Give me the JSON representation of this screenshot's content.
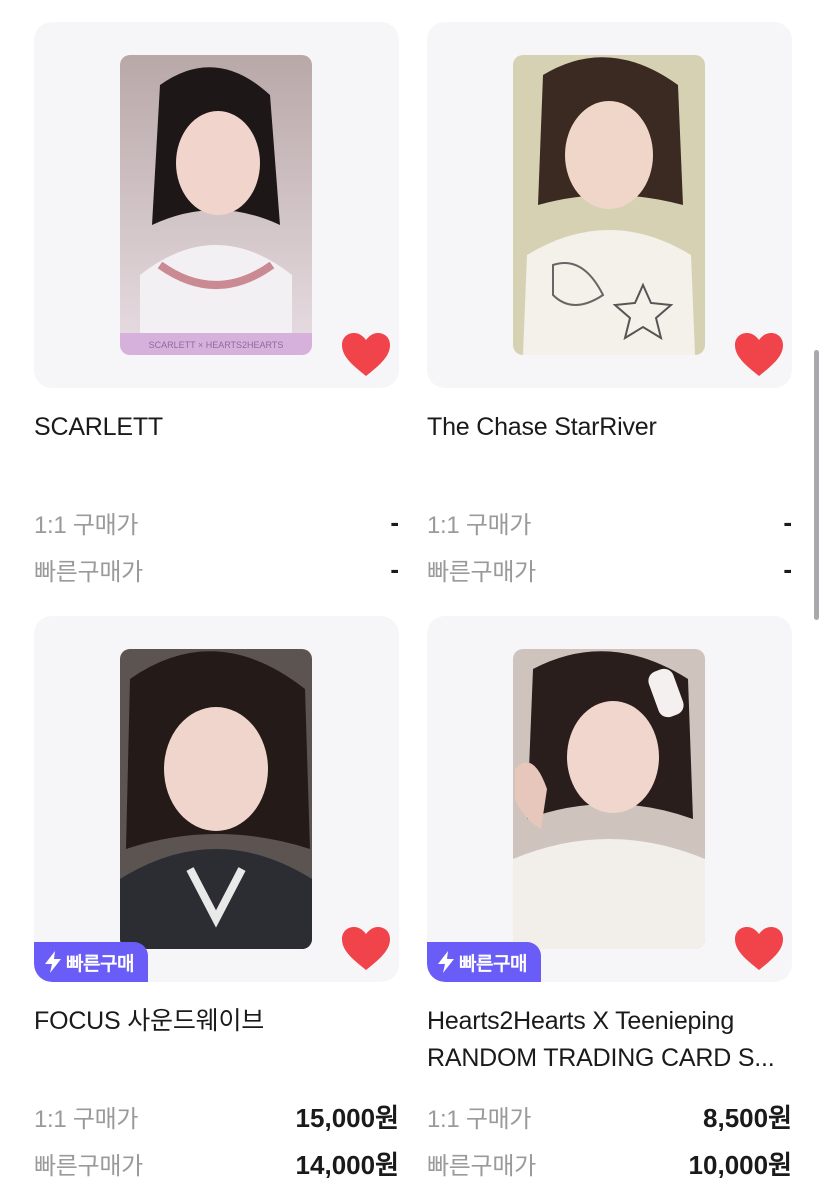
{
  "products": [
    {
      "title": "SCARLETT",
      "photo_label": "SCARLETT × HEARTS2HEARTS",
      "fast_badge": "",
      "one_to_one_label": "1:1 구매가",
      "one_to_one_price": "-",
      "fast_label": "빠른구매가",
      "fast_price": "-"
    },
    {
      "title": "The Chase StarRiver",
      "photo_label": "",
      "fast_badge": "",
      "one_to_one_label": "1:1 구매가",
      "one_to_one_price": "-",
      "fast_label": "빠른구매가",
      "fast_price": "-"
    },
    {
      "title": "FOCUS 사운드웨이브",
      "photo_label": "",
      "fast_badge": "빠른구매",
      "one_to_one_label": "1:1 구매가",
      "one_to_one_price": "15,000원",
      "fast_label": "빠른구매가",
      "fast_price": "14,000원"
    },
    {
      "title": "Hearts2Hearts X Teenieping RANDOM TRADING CARD S...",
      "photo_label": "",
      "fast_badge": "빠른구매",
      "one_to_one_label": "1:1 구매가",
      "one_to_one_price": "8,500원",
      "fast_label": "빠른구매가",
      "fast_price": "10,000원"
    }
  ],
  "colors": {
    "heart": "#f0434a",
    "badge": "#6a5cf6",
    "card_bg": "#f6f6f8"
  },
  "icons": {
    "wishlist": "heart-icon",
    "fast_buy": "lightning-bolt-icon"
  }
}
